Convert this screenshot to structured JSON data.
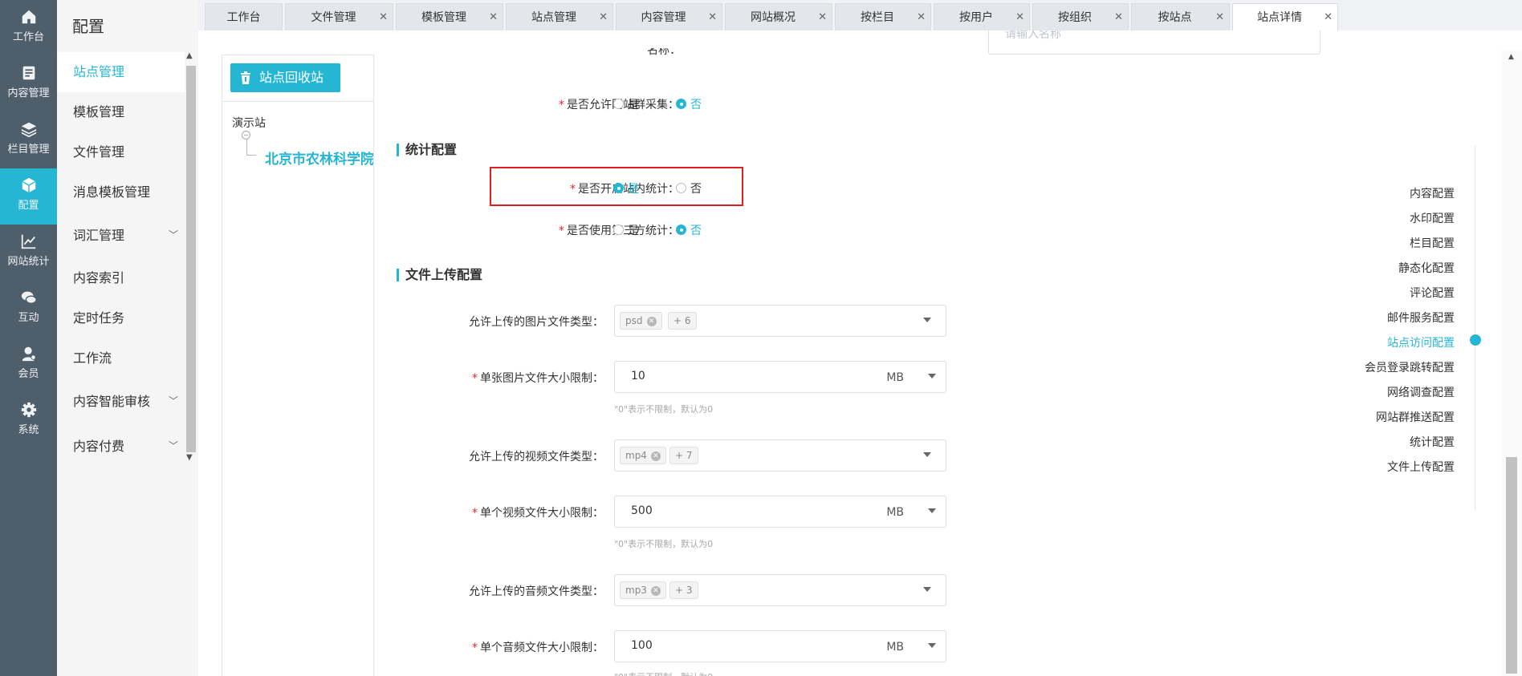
{
  "leftnav": [
    {
      "label": "工作台",
      "icon": "home-icon"
    },
    {
      "label": "内容管理",
      "icon": "document-icon"
    },
    {
      "label": "栏目管理",
      "icon": "layers-icon"
    },
    {
      "label": "配置",
      "icon": "cube-icon",
      "active": true
    },
    {
      "label": "网站统计",
      "icon": "chart-line-icon"
    },
    {
      "label": "互动",
      "icon": "chat-icon"
    },
    {
      "label": "会员",
      "icon": "user-icon"
    },
    {
      "label": "系统",
      "icon": "gear-icon"
    }
  ],
  "sidebar": {
    "title": "配置",
    "items": [
      {
        "label": "站点管理",
        "active": true
      },
      {
        "label": "模板管理"
      },
      {
        "label": "文件管理"
      },
      {
        "label": "消息模板管理"
      },
      {
        "label": "词汇管理",
        "expandable": true
      },
      {
        "label": "内容索引"
      },
      {
        "label": "定时任务"
      },
      {
        "label": "工作流"
      },
      {
        "label": "内容智能审核",
        "expandable": true
      },
      {
        "label": "内容付费",
        "expandable": true
      }
    ]
  },
  "tabs": [
    {
      "label": "工作台",
      "closable": false
    },
    {
      "label": "文件管理",
      "closable": true
    },
    {
      "label": "模板管理",
      "closable": true
    },
    {
      "label": "站点管理",
      "closable": true
    },
    {
      "label": "内容管理",
      "closable": true
    },
    {
      "label": "网站概况",
      "closable": true
    },
    {
      "label": "按栏目",
      "closable": true
    },
    {
      "label": "按用户",
      "closable": true
    },
    {
      "label": "按组织",
      "closable": true
    },
    {
      "label": "按站点",
      "closable": true
    },
    {
      "label": "站点详情",
      "closable": true,
      "active": true
    }
  ],
  "tree": {
    "recycle_button": "站点回收站",
    "root": "演示站",
    "child": "北京市农林科学院植物"
  },
  "form": {
    "top_placeholder": "请输入名称",
    "top_label_partial": "名称：",
    "allow_collect": {
      "label": "是否允许网站群采集：",
      "yes": "是",
      "no": "否",
      "value": "no"
    },
    "stat_section": "统计配置",
    "enable_stat": {
      "label": "是否开启站内统计：",
      "yes": "是",
      "no": "否",
      "value": "yes"
    },
    "third_stat": {
      "label": "是否使用第三方统计：",
      "yes": "是",
      "no": "否",
      "value": "no"
    },
    "upload_section": "文件上传配置",
    "image_types": {
      "label": "允许上传的图片文件类型：",
      "chip": "psd",
      "more": "+ 6"
    },
    "image_size": {
      "label": "单张图片文件大小限制：",
      "value": "10",
      "unit": "MB",
      "hint": "\"0\"表示不限制，默认为0"
    },
    "video_types": {
      "label": "允许上传的视频文件类型：",
      "chip": "mp4",
      "more": "+ 7"
    },
    "video_size": {
      "label": "单个视频文件大小限制：",
      "value": "500",
      "unit": "MB",
      "hint": "\"0\"表示不限制，默认为0"
    },
    "audio_types": {
      "label": "允许上传的音频文件类型：",
      "chip": "mp3",
      "more": "+ 3"
    },
    "audio_size": {
      "label": "单个音频文件大小限制：",
      "value": "100",
      "unit": "MB",
      "hint": "\"0\"表示不限制，默认为0"
    }
  },
  "anchors": [
    {
      "label": "内容配置"
    },
    {
      "label": "水印配置"
    },
    {
      "label": "栏目配置"
    },
    {
      "label": "静态化配置"
    },
    {
      "label": "评论配置"
    },
    {
      "label": "邮件服务配置"
    },
    {
      "label": "站点访问配置",
      "active": true
    },
    {
      "label": "会员登录跳转配置"
    },
    {
      "label": "网络调查配置"
    },
    {
      "label": "网站群推送配置"
    },
    {
      "label": "统计配置"
    },
    {
      "label": "文件上传配置"
    }
  ],
  "colors": {
    "accent": "#25b6d3",
    "nav_bg": "#4e5f6b",
    "highlight": "#e02020",
    "required": "#f5222d"
  }
}
